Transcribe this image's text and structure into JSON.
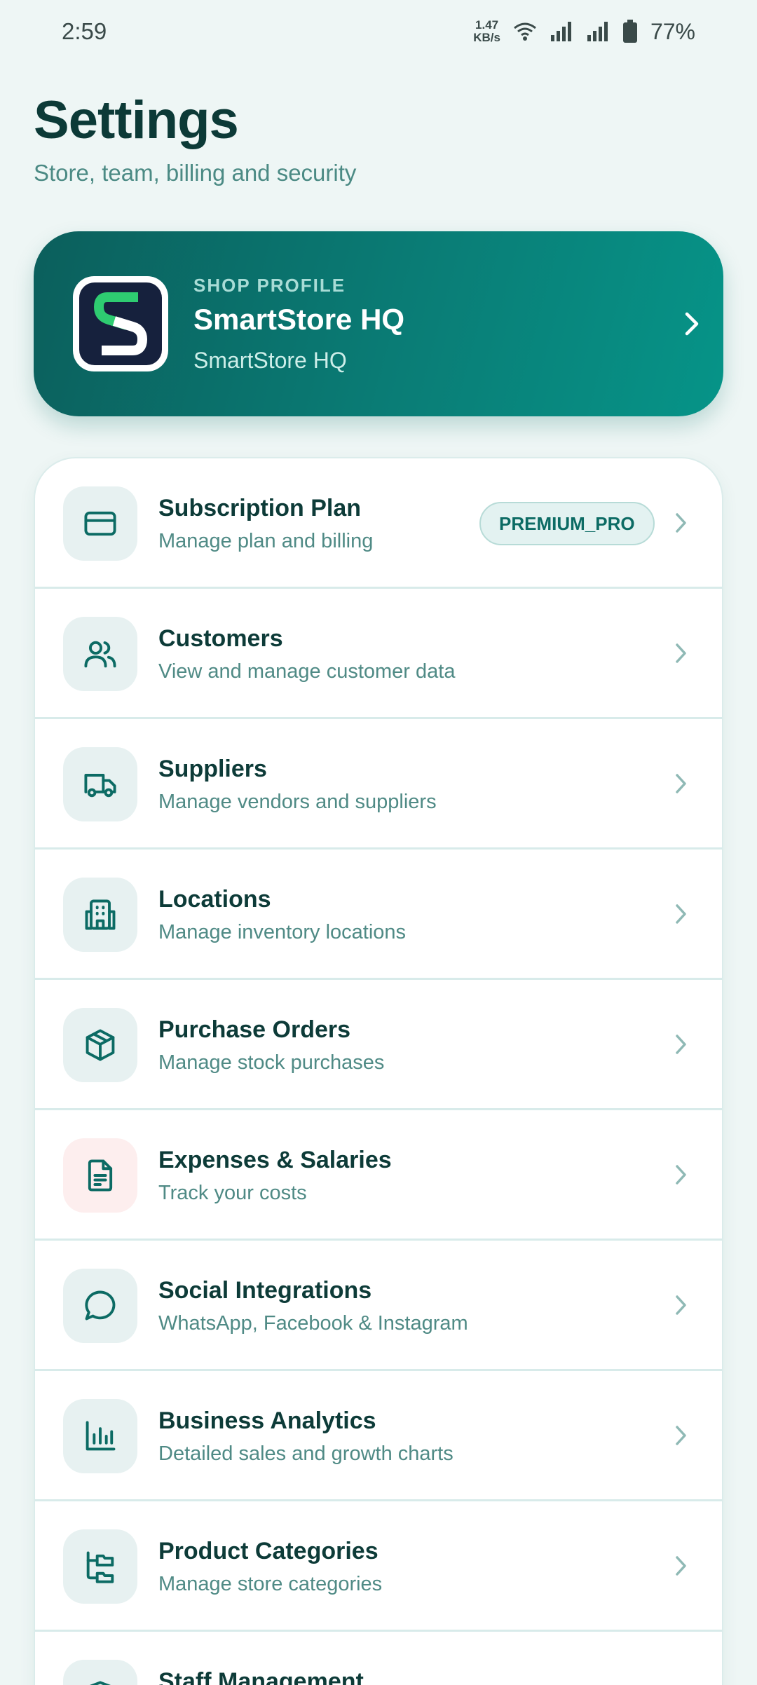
{
  "status_bar": {
    "time": "2:59",
    "net_speed_value": "1.47",
    "net_speed_unit": "KB/s",
    "battery": "77%"
  },
  "header": {
    "title": "Settings",
    "subtitle": "Store, team, billing and security"
  },
  "profile": {
    "eyebrow": "SHOP PROFILE",
    "name": "SmartStore HQ",
    "subtitle": "SmartStore HQ"
  },
  "colors": {
    "accent": "#0a7d76",
    "background": "#eef6f5",
    "title_text": "#0d3b38",
    "muted_text": "#4f8a85"
  },
  "menu": [
    {
      "icon": "credit-card-icon",
      "title": "Subscription Plan",
      "subtitle": "Manage plan and billing",
      "badge": "PREMIUM_PRO"
    },
    {
      "icon": "users-icon",
      "title": "Customers",
      "subtitle": "View and manage customer data"
    },
    {
      "icon": "truck-icon",
      "title": "Suppliers",
      "subtitle": "Manage vendors and suppliers"
    },
    {
      "icon": "building-icon",
      "title": "Locations",
      "subtitle": "Manage inventory locations"
    },
    {
      "icon": "box-icon",
      "title": "Purchase Orders",
      "subtitle": "Manage stock purchases"
    },
    {
      "icon": "document-icon",
      "title": "Expenses & Salaries",
      "subtitle": "Track your costs"
    },
    {
      "icon": "chat-bubble-icon",
      "title": "Social Integrations",
      "subtitle": "WhatsApp, Facebook & Instagram"
    },
    {
      "icon": "bar-chart-icon",
      "title": "Business Analytics",
      "subtitle": "Detailed sales and growth charts"
    },
    {
      "icon": "folder-tree-icon",
      "title": "Product Categories",
      "subtitle": "Manage store categories"
    },
    {
      "icon": "shield-icon",
      "title": "Staff Management",
      "subtitle": ""
    }
  ]
}
